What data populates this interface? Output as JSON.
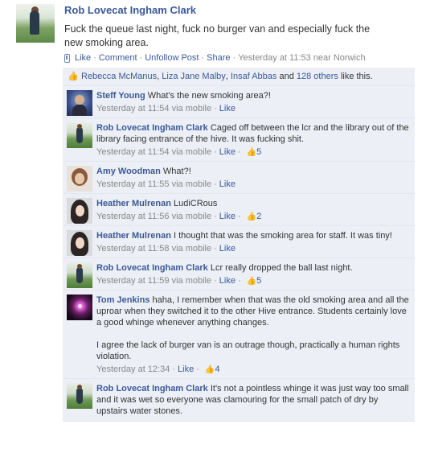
{
  "post": {
    "author": "Rob Lovecat Ingham Clark",
    "text": "Fuck the queue last night, fuck no burger van and especially fuck the new smoking area.",
    "actions": {
      "like": "Like",
      "comment": "Comment",
      "unfollow": "Unfollow Post",
      "share": "Share",
      "timestamp": "Yesterday at 11:53 near Norwich"
    }
  },
  "likes": {
    "people": [
      "Rebecca McManus",
      "Liza Jane Malby",
      "Insaf Abbas"
    ],
    "and": "and",
    "others": "128 others",
    "suffix": "like this."
  },
  "comments": [
    {
      "author": "Steff Young",
      "text": "What's the new smoking area?!",
      "time": "Yesterday at 11:54 via mobile",
      "like": "Like",
      "likes": "",
      "avatar": "steff"
    },
    {
      "author": "Rob Lovecat Ingham Clark",
      "text": "Caged off between the lcr and the library out of the library facing entrance of the hive. It was fucking shit.",
      "time": "Yesterday at 11:54 via mobile",
      "like": "Like",
      "likes": "5",
      "avatar": "rob"
    },
    {
      "author": "Amy Woodman",
      "text": "What?!",
      "time": "Yesterday at 11:55 via mobile",
      "like": "Like",
      "likes": "",
      "avatar": "amy"
    },
    {
      "author": "Heather Mulrenan",
      "text": "LudiCRous",
      "time": "Yesterday at 11:56 via mobile",
      "like": "Like",
      "likes": "2",
      "avatar": "heather"
    },
    {
      "author": "Heather Mulrenan",
      "text": "I thought that was the smoking area for staff. It was tiny!",
      "time": "Yesterday at 11:58 via mobile",
      "like": "Like",
      "likes": "",
      "avatar": "heather"
    },
    {
      "author": "Rob Lovecat Ingham Clark",
      "text": "Lcr really dropped the ball last night.",
      "time": "Yesterday at 11:59 via mobile",
      "like": "Like",
      "likes": "5",
      "avatar": "rob"
    },
    {
      "author": "Tom Jenkins",
      "text": "haha, I remember when that was the old smoking area and all the uproar when they switched it to the other Hive entrance. Students certainly love a good whinge whenever anything changes.",
      "text2": "I agree the lack of burger van is an outrage though, practically a human rights violation.",
      "time": "Yesterday at 12:34",
      "like": "Like",
      "likes": "4",
      "avatar": "tom"
    },
    {
      "author": "Rob Lovecat Ingham Clark",
      "text": "It's not a pointless whinge it was just way too small and it was wet so everyone was clamouring for the small patch of dry by upstairs water stones.",
      "time": "",
      "like": "",
      "likes": "",
      "avatar": "rob"
    }
  ]
}
